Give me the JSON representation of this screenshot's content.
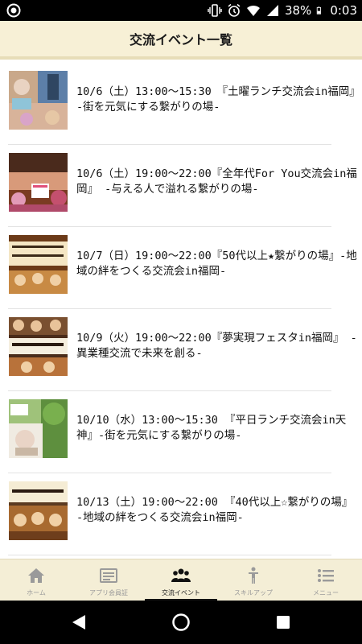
{
  "status_bar": {
    "battery_percent": "38%",
    "time": "0:03"
  },
  "header": {
    "title": "交流イベント一覧"
  },
  "events": [
    {
      "title": "10/6（土）13:00～15:30　『土曜ランチ交流会in福岡』　　　-街を元気にする繋がりの場-"
    },
    {
      "title": "10/6（土）19:00～22:00『全年代For You交流会in福岡』 -与える人で溢れる繋がりの場-"
    },
    {
      "title": "10/7（日）19:00～22:00『50代以上★繋がりの場』-地域の絆をつくる交流会in福岡-"
    },
    {
      "title": "10/9（火）19:00～22:00『夢実現フェスタin福岡』 -異業種交流で未来を創る-"
    },
    {
      "title": "10/10（水）13:00～15:30 『平日ランチ交流会in天神』-街を元気にする繋がりの場-"
    },
    {
      "title": "10/13（土）19:00～22:00 『40代以上☆繋がりの場』-地域の絆をつくる交流会in福岡-"
    }
  ],
  "bottom_nav": {
    "items": [
      {
        "label": "ホーム",
        "icon": "home-icon",
        "active": false
      },
      {
        "label": "アプリ会員証",
        "icon": "member-card-icon",
        "active": false
      },
      {
        "label": "交流イベント",
        "icon": "group-icon",
        "active": true
      },
      {
        "label": "スキルアップ",
        "icon": "person-icon",
        "active": false
      },
      {
        "label": "メニュー",
        "icon": "menu-list-icon",
        "active": false
      }
    ]
  },
  "colors": {
    "header_bg": "#f7f0d6",
    "nav_bg": "#f4eed6",
    "inactive_icon": "#9a9a9a",
    "active_icon": "#111111"
  }
}
